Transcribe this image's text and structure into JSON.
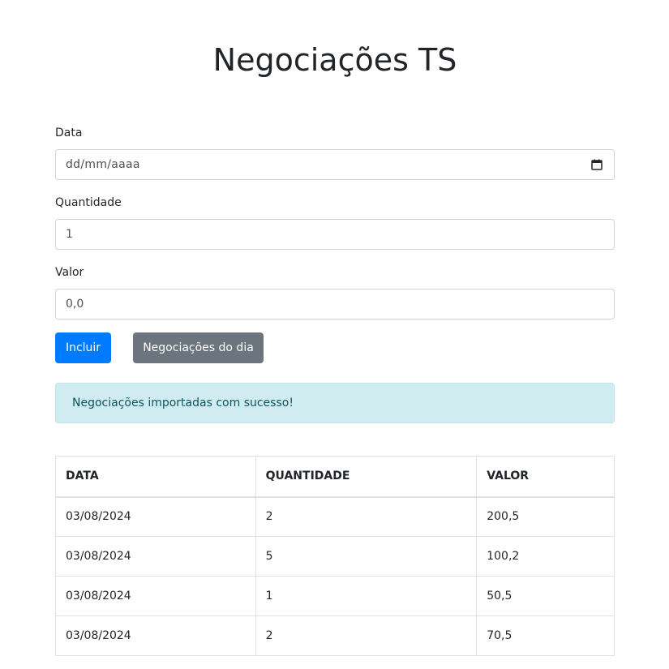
{
  "page": {
    "title": "Negociações TS"
  },
  "form": {
    "data_label": "Data",
    "data_placeholder": "dd/mm/aaaa",
    "quantidade_label": "Quantidade",
    "quantidade_value": "1",
    "valor_label": "Valor",
    "valor_value": "0,0"
  },
  "buttons": {
    "incluir": "Incluir",
    "negociacoes_do_dia": "Negociações do dia"
  },
  "alert": {
    "message": "Negociações importadas com sucesso!"
  },
  "table": {
    "headers": [
      "DATA",
      "QUANTIDADE",
      "VALOR"
    ],
    "rows": [
      [
        "03/08/2024",
        "2",
        "200,5"
      ],
      [
        "03/08/2024",
        "5",
        "100,2"
      ],
      [
        "03/08/2024",
        "1",
        "50,5"
      ],
      [
        "03/08/2024",
        "2",
        "70,5"
      ]
    ]
  },
  "colors": {
    "primary": "#007bff",
    "secondary": "#6c757d",
    "alert_bg": "#d1ecf1",
    "alert_text": "#0c5460"
  }
}
